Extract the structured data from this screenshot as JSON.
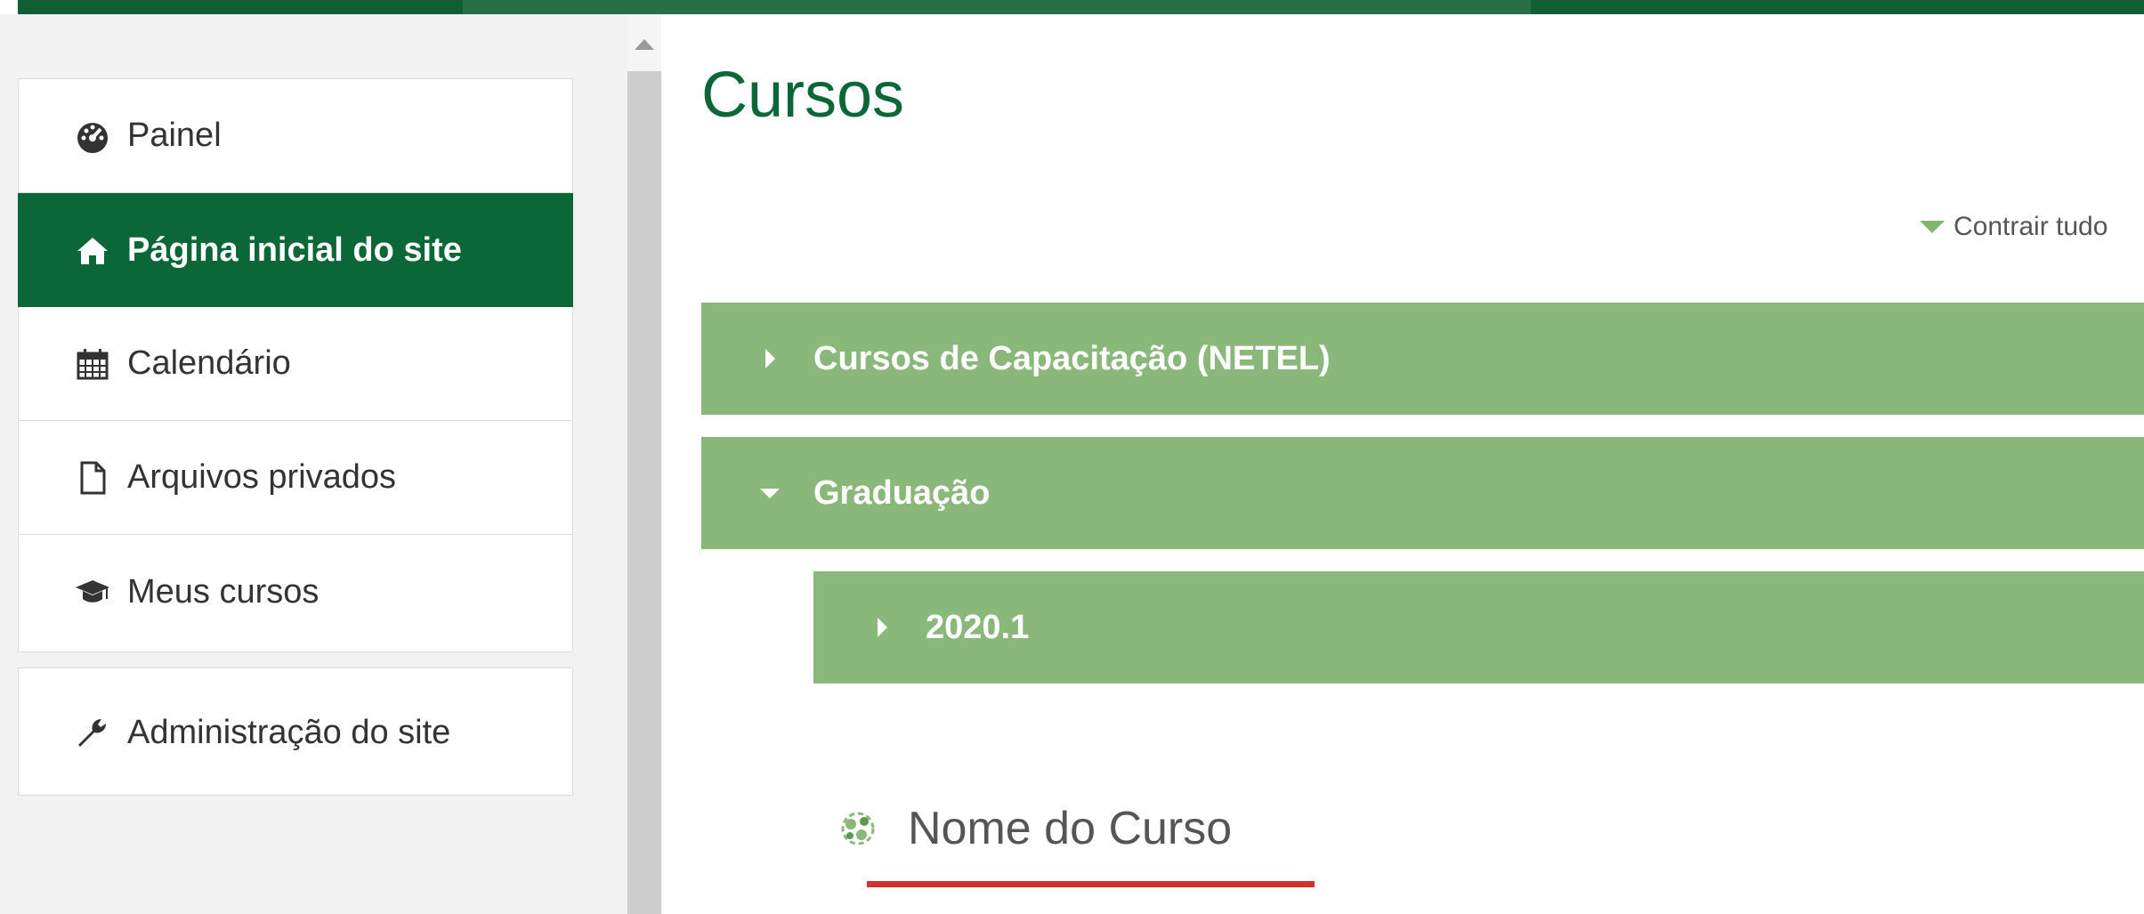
{
  "sidebar": {
    "items": [
      {
        "label": "Painel",
        "icon": "dashboard-icon",
        "active": false
      },
      {
        "label": "Página inicial do site",
        "icon": "home-icon",
        "active": true
      },
      {
        "label": "Calendário",
        "icon": "calendar-icon",
        "active": false
      },
      {
        "label": "Arquivos privados",
        "icon": "file-icon",
        "active": false
      },
      {
        "label": "Meus cursos",
        "icon": "graduation-cap-icon",
        "active": false
      }
    ],
    "admin": {
      "label": "Administração do site",
      "icon": "wrench-icon"
    }
  },
  "main": {
    "title": "Cursos",
    "collapse_all": "Contrair tudo",
    "categories": [
      {
        "label": "Cursos de Capacitação (NETEL)",
        "state": "collapsed"
      },
      {
        "label": "Graduação",
        "state": "expanded"
      },
      {
        "label": "2020.1",
        "state": "collapsed"
      }
    ],
    "course": {
      "name": "Nome do Curso",
      "icon": "course-icon"
    }
  },
  "colors": {
    "brand_dark_green": "#0b6638",
    "category_green": "#8ab87a",
    "underline_red": "#d42f2f"
  }
}
